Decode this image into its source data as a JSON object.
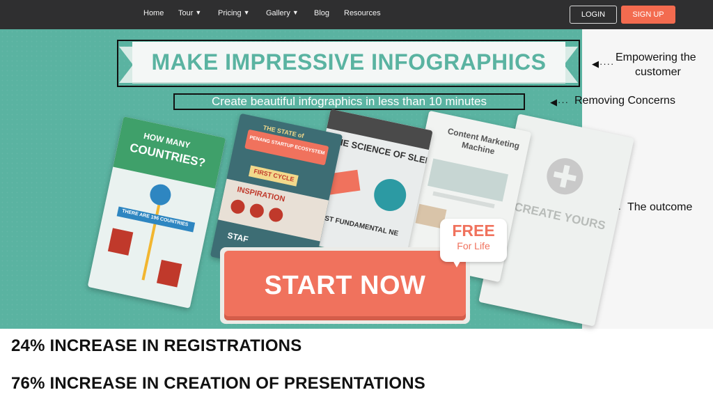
{
  "nav": {
    "items": [
      {
        "label": "Home",
        "dropdown": false
      },
      {
        "label": "Tour",
        "dropdown": true
      },
      {
        "label": "Pricing",
        "dropdown": true
      },
      {
        "label": "Gallery",
        "dropdown": true
      },
      {
        "label": "Blog",
        "dropdown": false
      },
      {
        "label": "Resources",
        "dropdown": false
      }
    ],
    "login_label": "LOGIN",
    "signup_label": "SIGN UP"
  },
  "hero": {
    "headline": "MAKE IMPRESSIVE INFOGRAPHICS",
    "subtitle": "Create beautiful infographics in less than 10 minutes",
    "cta_label": "START NOW",
    "badge_top": "FREE",
    "badge_bottom": "For Life",
    "cards": [
      {
        "title_1": "HOW MANY",
        "title_2": "COUNTRIES?",
        "caption": "THERE ARE 196 COUNTRIES"
      },
      {
        "title_1": "THE STATE of",
        "title_2": "PENANG STARTUP ECOSYSTEM",
        "label_1": "FIRST CYCLE",
        "label_2": "INSPIRATION",
        "label_3": "STAF"
      },
      {
        "title_1": "THE SCIENCE OF SLEEP",
        "caption": "MOST FUNDAMENTAL NE"
      },
      {
        "title_1": "Content Marketing",
        "title_2": "Machine"
      },
      {
        "title_1": "CREATE YOURS"
      }
    ]
  },
  "annotations": {
    "a1_line1": "Empowering the",
    "a1_line2": "customer",
    "a2": "Removing Concerns",
    "a3": "The outcome"
  },
  "stats": [
    "24% INCREASE IN REGISTRATIONS",
    "76% INCREASE IN CREATION OF PRESENTATIONS"
  ],
  "colors": {
    "nav_bg": "#2f2f30",
    "hero_bg": "#5ab3a1",
    "accent": "#f0725d",
    "signup": "#f36b4f"
  },
  "icons": {
    "dropdown": "chevron-down-icon",
    "plus": "plus-circle-icon",
    "arrow": "left-arrow-icon"
  }
}
